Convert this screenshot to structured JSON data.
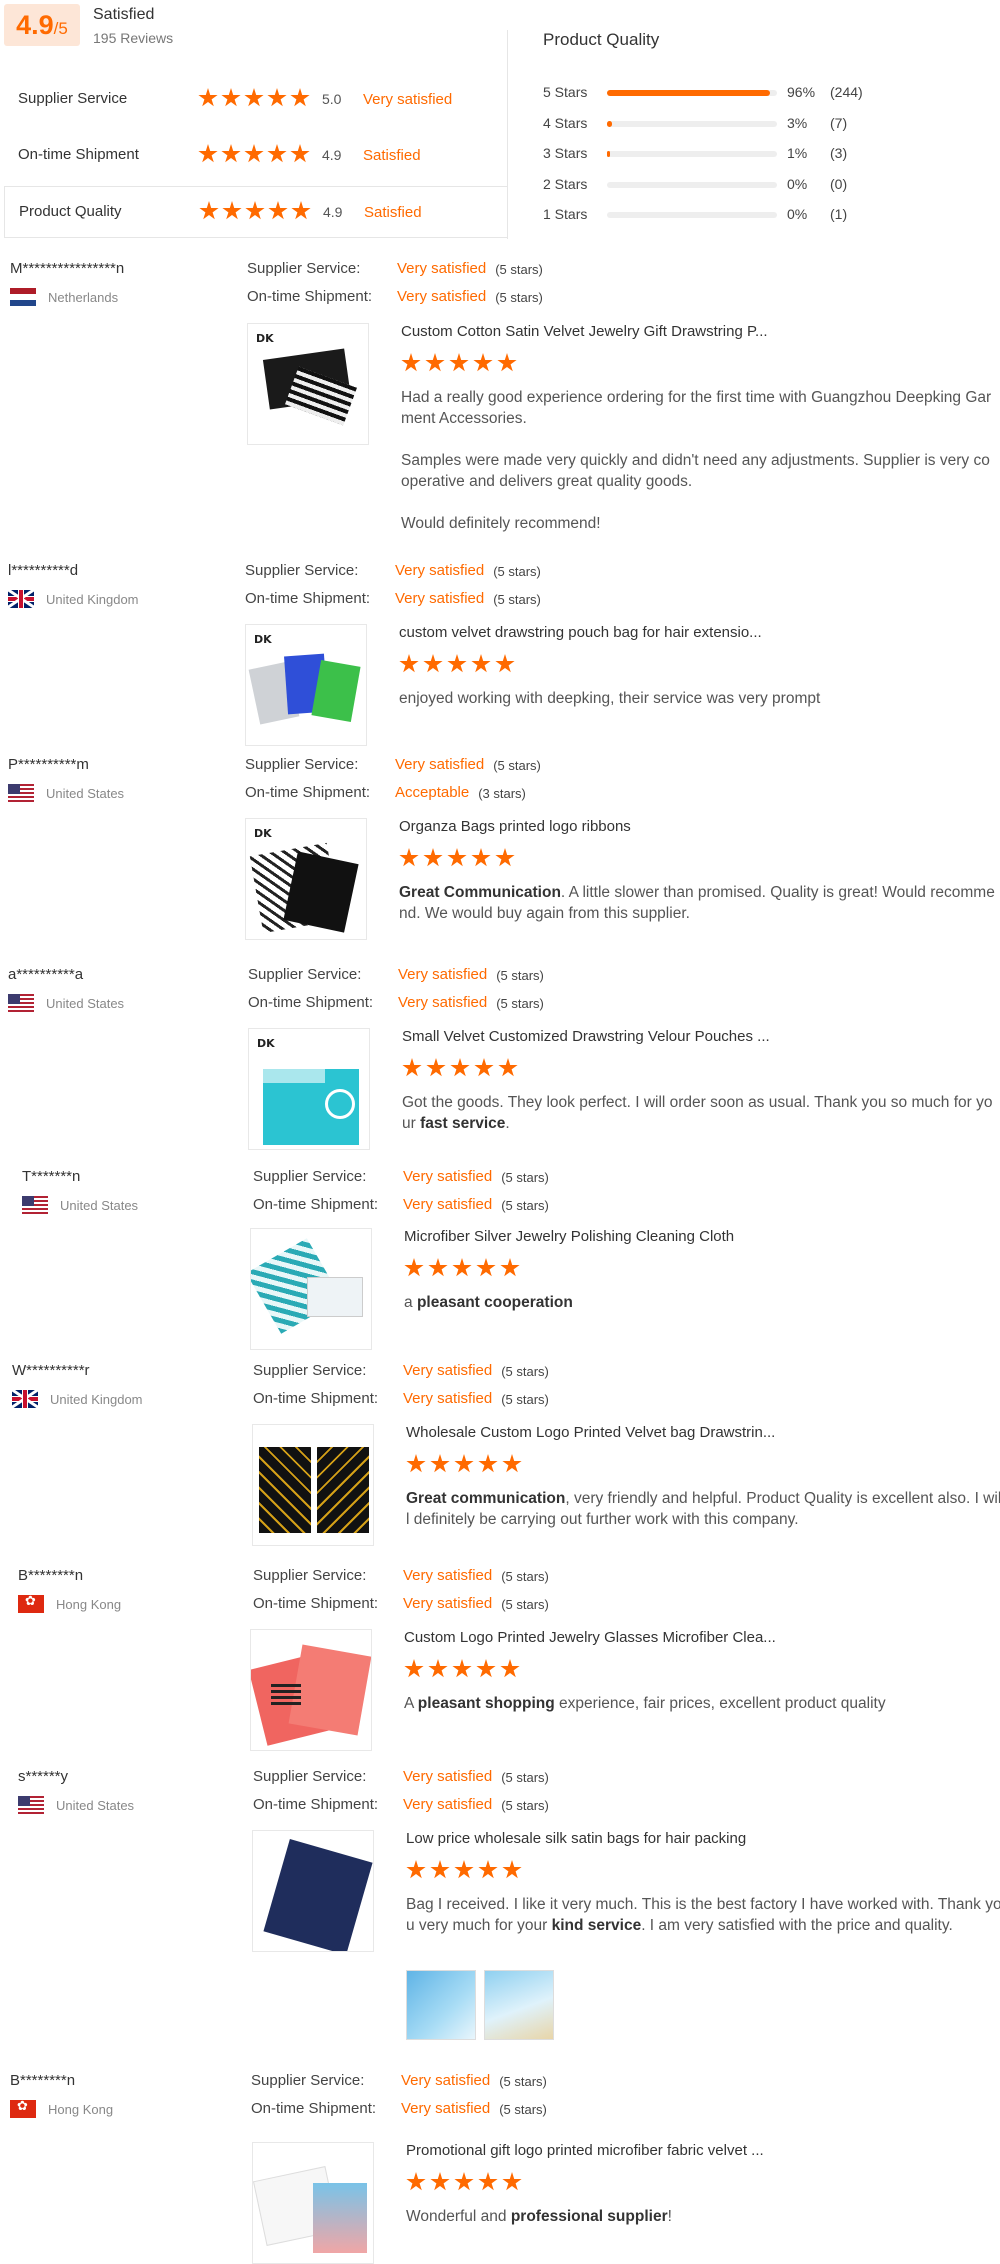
{
  "colors": {
    "accent": "#ff6a00",
    "score_bg": "#fde6d7"
  },
  "summary": {
    "score": "4.9",
    "score_max": "/5",
    "label": "Satisfied",
    "reviews_count": "195 Reviews",
    "metrics": [
      {
        "label": "Supplier Service",
        "score": "5.0",
        "word": "Very satisfied"
      },
      {
        "label": "On-time Shipment",
        "score": "4.9",
        "word": "Satisfied"
      },
      {
        "label": "Product Quality",
        "score": "4.9",
        "word": "Satisfied"
      }
    ],
    "distribution": {
      "title": "Product Quality",
      "rows": [
        {
          "label": "5 Stars",
          "pct": "96%",
          "fraction": 0.96,
          "count": "(244)"
        },
        {
          "label": "4 Stars",
          "pct": "3%",
          "fraction": 0.03,
          "count": "(7)"
        },
        {
          "label": "3 Stars",
          "pct": "1%",
          "fraction": 0.01,
          "count": "(3)"
        },
        {
          "label": "2 Stars",
          "pct": "0%",
          "fraction": 0.0,
          "count": "(0)"
        },
        {
          "label": "1 Stars",
          "pct": "0%",
          "fraction": 0.0,
          "count": "(1)"
        }
      ]
    }
  },
  "rating_labels": {
    "supplier": "Supplier Service:",
    "shipment": "On-time Shipment:"
  },
  "reviews": [
    {
      "buyer": "M****************n",
      "country": "Netherlands",
      "flag": "flag-nl",
      "supplier_word": "Very satisfied",
      "supplier_stars": "(5 stars)",
      "shipment_word": "Very satisfied",
      "shipment_stars": "(5 stars)",
      "product": "Custom Cotton Satin Velvet Jewelry Gift Drawstring P...",
      "rating": 5,
      "paragraphs": [
        "Had a really good experience ordering for the first time with Guangzhou Deepking Garment Accessories.",
        "Samples were made very quickly and didn't need any adjustments. Supplier is very cooperative and delivers great quality goods.",
        "Would definitely recommend!"
      ]
    },
    {
      "buyer": "l**********d",
      "country": "United Kingdom",
      "flag": "flag-uk",
      "supplier_word": "Very satisfied",
      "supplier_stars": "(5 stars)",
      "shipment_word": "Very satisfied",
      "shipment_stars": "(5 stars)",
      "product": "custom velvet drawstring pouch bag for hair extensio...",
      "rating": 5,
      "text": "enjoyed working with deepking, their service was very prompt"
    },
    {
      "buyer": "P**********m",
      "country": "United States",
      "flag": "flag-us",
      "supplier_word": "Very satisfied",
      "supplier_stars": "(5 stars)",
      "shipment_word": "Acceptable",
      "shipment_stars": "(3 stars)",
      "product": "Organza Bags printed logo ribbons",
      "rating": 5,
      "bold": "Great Communication",
      "text": ". A little slower than promised. Quality is great! Would recommend. We would buy again from this supplier."
    },
    {
      "buyer": "a**********a",
      "country": "United States",
      "flag": "flag-us",
      "supplier_word": "Very satisfied",
      "supplier_stars": "(5 stars)",
      "shipment_word": "Very satisfied",
      "shipment_stars": "(5 stars)",
      "product": "Small Velvet Customized Drawstring Velour Pouches ...",
      "rating": 5,
      "text": "Got the goods. They look perfect. I will order soon as usual. Thank you so much for your ",
      "bold_end": "fast service",
      "text_end": "."
    },
    {
      "buyer": "T*******n",
      "country": "United States",
      "flag": "flag-us",
      "supplier_word": "Very satisfied",
      "supplier_stars": "(5 stars)",
      "shipment_word": "Very satisfied",
      "shipment_stars": "(5 stars)",
      "product": "Microfiber Silver Jewelry Polishing Cleaning Cloth",
      "rating": 5,
      "text": "a ",
      "bold_end": "pleasant cooperation"
    },
    {
      "buyer": "W**********r",
      "country": "United Kingdom",
      "flag": "flag-uk",
      "supplier_word": "Very satisfied",
      "supplier_stars": "(5 stars)",
      "shipment_word": "Very satisfied",
      "shipment_stars": "(5 stars)",
      "product": "Wholesale Custom Logo Printed Velvet bag Drawstrin...",
      "rating": 5,
      "bold": "Great communication",
      "text": ", very friendly and helpful.  Product Quality is excellent also. I will definitely be carrying out further work with this company."
    },
    {
      "buyer": "B********n",
      "country": "Hong Kong",
      "flag": "flag-hk",
      "supplier_word": "Very satisfied",
      "supplier_stars": "(5 stars)",
      "shipment_word": "Very satisfied",
      "shipment_stars": "(5 stars)",
      "product": "Custom Logo Printed Jewelry Glasses Microfiber Clea...",
      "rating": 5,
      "text": "A ",
      "bold_end": "pleasant shopping",
      "text_end": " experience, fair prices, excellent product quality"
    },
    {
      "buyer": "s******y",
      "country": "United States",
      "flag": "flag-us",
      "supplier_word": "Very satisfied",
      "supplier_stars": "(5 stars)",
      "shipment_word": "Very satisfied",
      "shipment_stars": "(5 stars)",
      "product": "Low price wholesale silk satin bags for hair packing",
      "rating": 5,
      "text": "Bag I received. I like it very much. This is the best factory I have worked with. Thank you very much for your ",
      "bold_end": "kind service",
      "text_end": ". I am very satisfied with the price and quality."
    },
    {
      "buyer": "B********n",
      "country": "Hong Kong",
      "flag": "flag-hk",
      "supplier_word": "Very satisfied",
      "supplier_stars": "(5 stars)",
      "shipment_word": "Very satisfied",
      "shipment_stars": "(5 stars)",
      "product": "Promotional gift logo printed microfiber fabric velvet ...",
      "rating": 5,
      "text": "Wonderful and ",
      "bold_end": "professional supplier",
      "text_end": "!"
    }
  ]
}
